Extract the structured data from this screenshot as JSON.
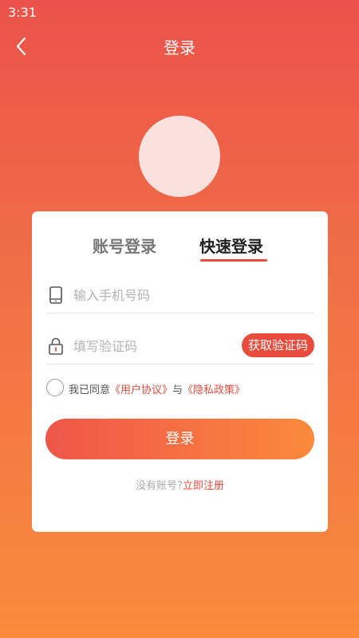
{
  "status_bar": {
    "time": "3:31"
  },
  "nav": {
    "title": "登录"
  },
  "tabs": {
    "account": "账号登录",
    "quick": "快速登录"
  },
  "phone_field": {
    "placeholder": "输入手机号码",
    "value": ""
  },
  "code_field": {
    "placeholder": "填写验证码",
    "value": "",
    "get_code_label": "获取验证码"
  },
  "agreement": {
    "prefix": "我已同意",
    "user_agreement": "《用户协议》",
    "conjunction": "与",
    "privacy_policy": "《隐私政策》",
    "checked": false
  },
  "login_button": {
    "label": "登录"
  },
  "register": {
    "prompt": "没有账号?",
    "link": "立即注册"
  },
  "colors": {
    "accent": "#e84c3d",
    "gradient_top": "#ec524a",
    "gradient_bottom": "#fb8a3c",
    "avatar": "#fbe1de"
  },
  "icons": {
    "back": "chevron-left-icon",
    "phone": "phone-icon",
    "lock": "lock-icon"
  }
}
